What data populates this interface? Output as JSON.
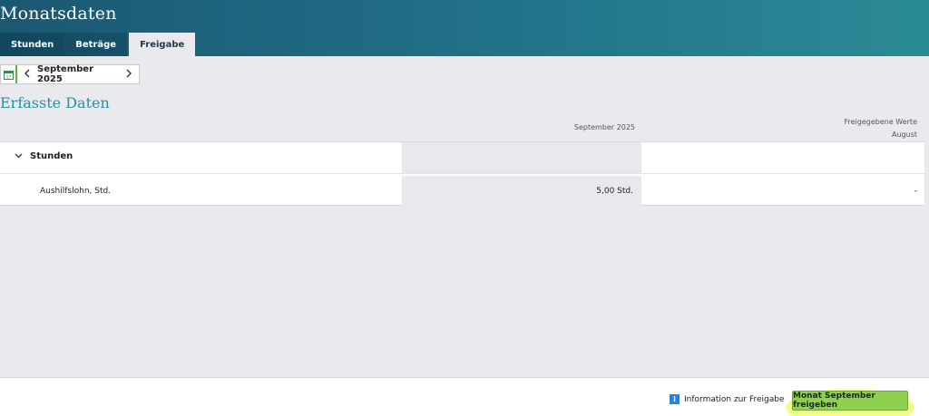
{
  "header": {
    "title": "Monatsdaten",
    "tabs": [
      {
        "label": "Stunden"
      },
      {
        "label": "Beträge"
      },
      {
        "label": "Freigabe",
        "active": true
      }
    ]
  },
  "period": {
    "label": "September 2025",
    "prev_icon": "chevron-left-icon",
    "next_icon": "chevron-right-icon",
    "calendar_icon": "calendar-icon"
  },
  "section": {
    "title": "Erfasste Daten"
  },
  "columns": {
    "current": "September 2025",
    "released_title": "Freigegebene Werte",
    "released_month": "August"
  },
  "table": {
    "group": {
      "label": "Stunden",
      "icon": "chevron-down-icon"
    },
    "rows": [
      {
        "label": "Aushilfslohn, Std.",
        "current": "5,00 Std.",
        "released": "-"
      }
    ]
  },
  "footer": {
    "info_label": "Information zur Freigabe",
    "info_icon": "info-icon",
    "release_button": "Monat September freigeben",
    "highlight_color": "#e6ff28",
    "button_color": "#8fd14f"
  }
}
